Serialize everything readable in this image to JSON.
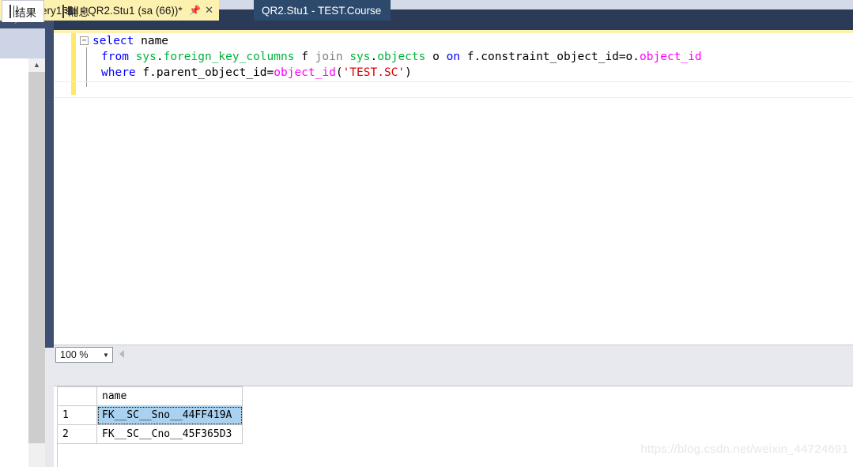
{
  "window": {
    "left_panel": {
      "caret_icon": "chevron-down-icon",
      "pin_icon": "pin-icon",
      "close_icon": "close-icon",
      "scroll_up_icon": "chevron-up-icon"
    }
  },
  "tabs": [
    {
      "label": "SQLQuery1.sql - QR2.Stu1 (sa (66))*",
      "active": true,
      "pin_icon": "pin-icon",
      "close_icon": "close-icon"
    },
    {
      "label": "QR2.Stu1 - TEST.Course",
      "active": false
    }
  ],
  "editor": {
    "collapse_glyph": "−",
    "lines": [
      {
        "tokens": [
          {
            "text": "select",
            "kind": "keyword"
          },
          {
            "text": " name",
            "kind": "ident"
          }
        ]
      },
      {
        "tokens": [
          {
            "text": "from",
            "kind": "keyword"
          },
          {
            "text": " ",
            "kind": "ident"
          },
          {
            "text": "sys",
            "kind": "schema"
          },
          {
            "text": ".",
            "kind": "ident"
          },
          {
            "text": "foreign_key_columns",
            "kind": "schema"
          },
          {
            "text": " f ",
            "kind": "ident"
          },
          {
            "text": "join",
            "kind": "keyword-gray"
          },
          {
            "text": " ",
            "kind": "ident"
          },
          {
            "text": "sys",
            "kind": "schema"
          },
          {
            "text": ".",
            "kind": "ident"
          },
          {
            "text": "objects",
            "kind": "schema"
          },
          {
            "text": " o ",
            "kind": "ident"
          },
          {
            "text": "on",
            "kind": "keyword"
          },
          {
            "text": " f.constraint_object_id=o.",
            "kind": "ident"
          },
          {
            "text": "object_id",
            "kind": "function"
          }
        ]
      },
      {
        "tokens": [
          {
            "text": "where",
            "kind": "keyword"
          },
          {
            "text": " f.parent_object_id=",
            "kind": "ident"
          },
          {
            "text": "object_id",
            "kind": "function"
          },
          {
            "text": "(",
            "kind": "ident"
          },
          {
            "text": "'TEST.SC'",
            "kind": "string"
          },
          {
            "text": ")",
            "kind": "ident"
          }
        ]
      }
    ]
  },
  "zoom_bar": {
    "value": "100 %",
    "caret_icon": "chevron-down-icon",
    "left_arrow_icon": "triangle-left-icon"
  },
  "result_tabs": [
    {
      "label": "结果",
      "icon": "grid-icon",
      "active": true
    },
    {
      "label": "消息",
      "icon": "message-icon",
      "active": false
    }
  ],
  "result_grid": {
    "columns": [
      "",
      "name"
    ],
    "rows": [
      {
        "num": "1",
        "name": "FK__SC__Sno__44FF419A",
        "selected": true
      },
      {
        "num": "2",
        "name": "FK__SC__Cno__45F365D3",
        "selected": false
      }
    ]
  },
  "watermark": "https://blog.csdn.net/weixin_44724691",
  "colors": {
    "tab_active_bg": "#fdf1b0",
    "tab_inactive_bg": "#2d4a6d",
    "tabstrip_bg": "#2b3a57",
    "keyword": "#0000ff",
    "keyword_gray": "#808080",
    "schema": "#00b33c",
    "function": "#ff00ff",
    "string": "#dd0000",
    "selection": "#a9d2f0",
    "changebar": "#ffe96b"
  }
}
